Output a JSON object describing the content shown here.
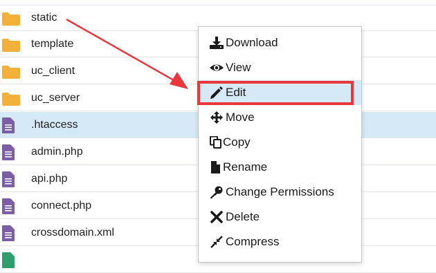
{
  "files": [
    {
      "name": "static",
      "type": "folder",
      "selected": false
    },
    {
      "name": "template",
      "type": "folder",
      "selected": false
    },
    {
      "name": "uc_client",
      "type": "folder",
      "selected": false
    },
    {
      "name": "uc_server",
      "type": "folder",
      "selected": false
    },
    {
      "name": ".htaccess",
      "type": "file",
      "selected": true
    },
    {
      "name": "admin.php",
      "type": "file",
      "selected": false
    },
    {
      "name": "api.php",
      "type": "file",
      "selected": false
    },
    {
      "name": "connect.php",
      "type": "file",
      "selected": false
    },
    {
      "name": "crossdomain.xml",
      "type": "file",
      "selected": false
    }
  ],
  "context_menu": {
    "items": [
      {
        "label": "Download",
        "icon": "download-icon"
      },
      {
        "label": "View",
        "icon": "eye-icon"
      },
      {
        "label": "Edit",
        "icon": "pencil-icon"
      },
      {
        "label": "Move",
        "icon": "move-arrows-icon"
      },
      {
        "label": "Copy",
        "icon": "copy-icon"
      },
      {
        "label": "Rename",
        "icon": "file-icon"
      },
      {
        "label": "Change Permissions",
        "icon": "key-icon"
      },
      {
        "label": "Delete",
        "icon": "x-icon"
      },
      {
        "label": "Compress",
        "icon": "compress-icon"
      }
    ]
  },
  "colors": {
    "folder": "#f3b13a",
    "file": "#7b5ea7",
    "selected_row": "#d6e9f7",
    "annotation": "#e8383d"
  }
}
